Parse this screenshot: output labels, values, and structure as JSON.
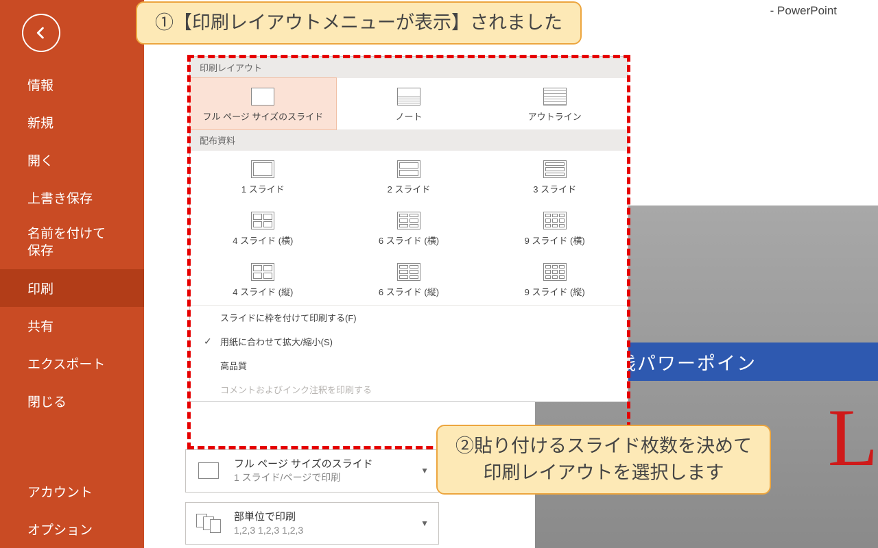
{
  "window": {
    "title_suffix": "- PowerPoint"
  },
  "sidebar": {
    "items": [
      "情報",
      "新規",
      "開く",
      "上書き保存",
      "名前を付けて\n保存",
      "印刷",
      "共有",
      "エクスポート",
      "閉じる"
    ],
    "active_index": 5,
    "bottom": [
      "アカウント",
      "オプション"
    ]
  },
  "popup": {
    "sec1_header": "印刷レイアウト",
    "sec1_opts": [
      "フル ページ サイズのスライド",
      "ノート",
      "アウトライン"
    ],
    "sec1_selected": 0,
    "sec2_header": "配布資料",
    "sec2_opts": [
      "1 スライド",
      "2 スライド",
      "3 スライド",
      "4 スライド (横)",
      "6 スライド (横)",
      "9 スライド (横)",
      "4 スライド (縦)",
      "6 スライド (縦)",
      "9 スライド (縦)"
    ],
    "bottom_opts": [
      {
        "label": "スライドに枠を付けて印刷する(F)",
        "checked": false,
        "disabled": false
      },
      {
        "label": "用紙に合わせて拡大/縮小(S)",
        "checked": true,
        "disabled": false
      },
      {
        "label": "高品質",
        "checked": false,
        "disabled": false
      },
      {
        "label": "コメントおよびインク注釈を印刷する",
        "checked": false,
        "disabled": true
      }
    ]
  },
  "settings": {
    "dd1": {
      "line1": "フル ページ サイズのスライド",
      "line2": "1 スライド/ページで印刷"
    },
    "dd2": {
      "line1": "部単位で印刷",
      "line2": "1,2,3   1,2,3   1,2,3"
    }
  },
  "callouts": {
    "c1": "①【印刷レイアウトメニューが表示】されました",
    "c2a": "②貼り付けるスライド枚数を決めて",
    "c2b": "印刷レイアウトを選択します"
  },
  "preview": {
    "band_text": "習得・実践パワーポイン"
  }
}
